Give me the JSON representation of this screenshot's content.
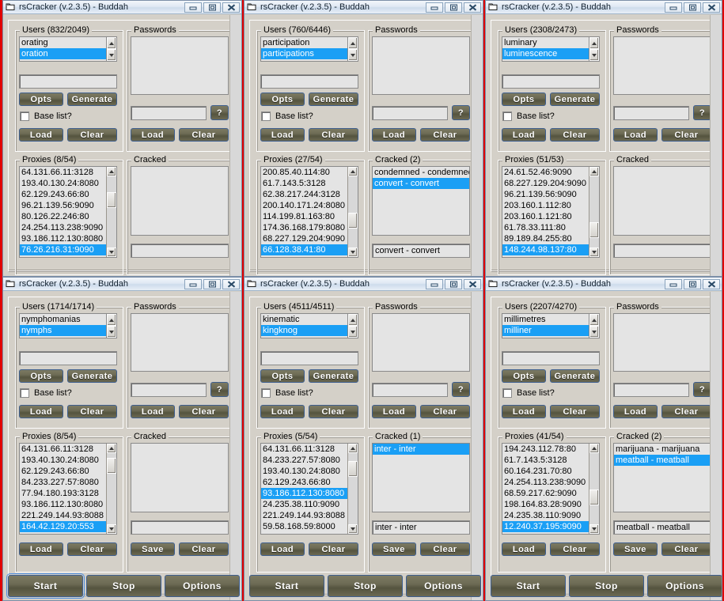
{
  "app": {
    "title": "rsCracker (v.2.3.5) - Buddah",
    "icon": "folder-icon",
    "titlebar_buttons": [
      {
        "name": "minimize-button",
        "glyph": "minimize-icon"
      },
      {
        "name": "maximize-button",
        "glyph": "maximize-icon"
      },
      {
        "name": "close-button",
        "glyph": "close-icon"
      }
    ]
  },
  "labels": {
    "users": "Users",
    "passwords": "Passwords",
    "proxies": "Proxies",
    "cracked": "Cracked",
    "opts": "Opts",
    "generate": "Generate",
    "base_list": "Base list?",
    "load": "Load",
    "clear": "Clear",
    "save": "Save",
    "question": "?",
    "start": "Start",
    "stop": "Stop",
    "options": "Options"
  },
  "colors": {
    "desktop_red": "#e00000",
    "window_face": "#d4d0c8",
    "selection_blue": "#1a9ff5",
    "button_olive": "#6d6b55",
    "button_border_blue": "#3e5f8f",
    "titlebar_light": "#eaf1f8"
  },
  "windows": [
    {
      "id": "window-1",
      "users_title": "Users (832/2049)",
      "users_items": [
        {
          "text": "orating",
          "selected": false
        },
        {
          "text": "oration",
          "selected": true
        }
      ],
      "users_input": "",
      "base_list_checked": false,
      "passwords_title": "Passwords",
      "passwords_items": [],
      "passwords_input": "",
      "proxies_title": "Proxies (8/54)",
      "proxies_items": [
        {
          "text": "64.131.66.11:3128",
          "selected": false
        },
        {
          "text": "193.40.130.24:8080",
          "selected": false
        },
        {
          "text": "62.129.243.66:80",
          "selected": false
        },
        {
          "text": "96.21.139.56:9090",
          "selected": false
        },
        {
          "text": "80.126.22.246:80",
          "selected": false
        },
        {
          "text": "24.254.113.238:9090",
          "selected": false
        },
        {
          "text": "93.186.112.130:8080",
          "selected": false
        },
        {
          "text": "76.26.216.31:9090",
          "selected": true
        }
      ],
      "cracked_title": "Cracked",
      "cracked_items": [],
      "cracked_input": "",
      "show_bottom_row": false,
      "start_focused": false
    },
    {
      "id": "window-2",
      "users_title": "Users (760/6446)",
      "users_items": [
        {
          "text": "participation",
          "selected": false
        },
        {
          "text": "participations",
          "selected": true
        }
      ],
      "users_input": "",
      "base_list_checked": false,
      "passwords_title": "Passwords",
      "passwords_items": [],
      "passwords_input": "",
      "proxies_title": "Proxies (27/54)",
      "proxies_items": [
        {
          "text": "200.85.40.114:80",
          "selected": false
        },
        {
          "text": "61.7.143.5:3128",
          "selected": false
        },
        {
          "text": "62.38.217.244:3128",
          "selected": false
        },
        {
          "text": "200.140.171.24:8080",
          "selected": false
        },
        {
          "text": "114.199.81.163:80",
          "selected": false
        },
        {
          "text": "174.36.168.179:8080",
          "selected": false
        },
        {
          "text": "68.227.129.204:9090",
          "selected": false
        },
        {
          "text": "66.128.38.41:80",
          "selected": true
        }
      ],
      "cracked_title": "Cracked (2)",
      "cracked_items": [
        {
          "text": "condemned - condemned",
          "selected": false
        },
        {
          "text": "convert - convert",
          "selected": true
        }
      ],
      "cracked_input": "convert - convert",
      "show_bottom_row": false,
      "start_focused": false
    },
    {
      "id": "window-3",
      "users_title": "Users (2308/2473)",
      "users_items": [
        {
          "text": "luminary",
          "selected": false
        },
        {
          "text": "luminescence",
          "selected": true
        }
      ],
      "users_input": "",
      "base_list_checked": false,
      "passwords_title": "Passwords",
      "passwords_items": [],
      "passwords_input": "",
      "proxies_title": "Proxies (51/53)",
      "proxies_items": [
        {
          "text": "24.61.52.46:9090",
          "selected": false
        },
        {
          "text": "68.227.129.204:9090",
          "selected": false
        },
        {
          "text": "96.21.139.56:9090",
          "selected": false
        },
        {
          "text": "203.160.1.112:80",
          "selected": false
        },
        {
          "text": "203.160.1.121:80",
          "selected": false
        },
        {
          "text": "61.78.33.111:80",
          "selected": false
        },
        {
          "text": "89.189.84.255:80",
          "selected": false
        },
        {
          "text": "148.244.98.137:80",
          "selected": true
        }
      ],
      "cracked_title": "Cracked",
      "cracked_items": [],
      "cracked_input": "",
      "show_bottom_row": false,
      "start_focused": false
    },
    {
      "id": "window-4",
      "users_title": "Users (1714/1714)",
      "users_items": [
        {
          "text": "nymphomanias",
          "selected": false
        },
        {
          "text": "nymphs",
          "selected": true
        }
      ],
      "users_input": "",
      "base_list_checked": false,
      "passwords_title": "Passwords",
      "passwords_items": [],
      "passwords_input": "",
      "proxies_title": "Proxies (8/54)",
      "proxies_items": [
        {
          "text": "64.131.66.11:3128",
          "selected": false
        },
        {
          "text": "193.40.130.24:8080",
          "selected": false
        },
        {
          "text": "62.129.243.66:80",
          "selected": false
        },
        {
          "text": "84.233.227.57:8080",
          "selected": false
        },
        {
          "text": "77.94.180.193:3128",
          "selected": false
        },
        {
          "text": "93.186.112.130:8080",
          "selected": false
        },
        {
          "text": "221.249.144.93:8088",
          "selected": false
        },
        {
          "text": "164.42.129.20:553",
          "selected": true
        }
      ],
      "cracked_title": "Cracked",
      "cracked_items": [],
      "cracked_input": "",
      "show_bottom_row": true,
      "start_focused": true
    },
    {
      "id": "window-5",
      "users_title": "Users (4511/4511)",
      "users_items": [
        {
          "text": "kinematic",
          "selected": false
        },
        {
          "text": "kingknog",
          "selected": true
        }
      ],
      "users_input": "",
      "base_list_checked": false,
      "passwords_title": "Passwords",
      "passwords_items": [],
      "passwords_input": "",
      "proxies_title": "Proxies (5/54)",
      "proxies_items": [
        {
          "text": "64.131.66.11:3128",
          "selected": false
        },
        {
          "text": "84.233.227.57:8080",
          "selected": false
        },
        {
          "text": "193.40.130.24:8080",
          "selected": false
        },
        {
          "text": "62.129.243.66:80",
          "selected": false
        },
        {
          "text": "93.186.112.130:8080",
          "selected": true
        },
        {
          "text": "24.235.38.110:9090",
          "selected": false
        },
        {
          "text": "221.249.144.93:8088",
          "selected": false
        },
        {
          "text": "59.58.168.59:8000",
          "selected": false
        }
      ],
      "cracked_title": "Cracked (1)",
      "cracked_items": [
        {
          "text": "inter - inter",
          "selected": true
        }
      ],
      "cracked_input": "inter - inter",
      "show_bottom_row": true,
      "start_focused": false
    },
    {
      "id": "window-6",
      "users_title": "Users (2207/4270)",
      "users_items": [
        {
          "text": "millimetres",
          "selected": false
        },
        {
          "text": "milliner",
          "selected": true
        }
      ],
      "users_input": "",
      "base_list_checked": false,
      "passwords_title": "Passwords",
      "passwords_items": [],
      "passwords_input": "",
      "proxies_title": "Proxies (41/54)",
      "proxies_items": [
        {
          "text": "194.243.112.78:80",
          "selected": false
        },
        {
          "text": "61.7.143.5:3128",
          "selected": false
        },
        {
          "text": "60.164.231.70:80",
          "selected": false
        },
        {
          "text": "24.254.113.238:9090",
          "selected": false
        },
        {
          "text": "68.59.217.62:9090",
          "selected": false
        },
        {
          "text": "198.164.83.28:9090",
          "selected": false
        },
        {
          "text": "24.235.38.110:9090",
          "selected": false
        },
        {
          "text": "12.240.37.195:9090",
          "selected": true
        }
      ],
      "cracked_title": "Cracked (2)",
      "cracked_items": [
        {
          "text": "marijuana - marijuana",
          "selected": false
        },
        {
          "text": "meatball - meatball",
          "selected": true
        }
      ],
      "cracked_input": "meatball - meatball",
      "show_bottom_row": true,
      "start_focused": false
    }
  ]
}
